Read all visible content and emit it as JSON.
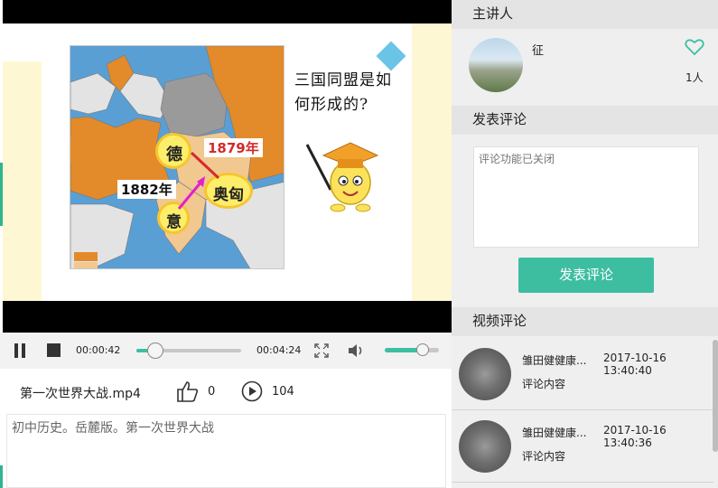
{
  "slide": {
    "question": "三国同盟是如何形成的?",
    "label_de": "德",
    "label_aoxiong": "奥匈",
    "label_yi": "意",
    "year_1879": "1879年",
    "year_1882": "1882年"
  },
  "player": {
    "current_time": "00:00:42",
    "total_time": "00:04:24",
    "progress": 0.18,
    "volume": 0.7
  },
  "video": {
    "filename": "第一次世界大战.mp4",
    "likes": "0",
    "plays": "104",
    "description": "初中历史。岳麓版。第一次世界大战"
  },
  "lecturer": {
    "section_title": "主讲人",
    "name": "征",
    "followers": "1人"
  },
  "comment_form": {
    "section_title": "发表评论",
    "placeholder": "评论功能已关闭",
    "submit_label": "发表评论"
  },
  "comments": {
    "section_title": "视频评论",
    "items": [
      {
        "user": "雏田健健康...",
        "date": "2017-10-16 13:40:40",
        "content": "评论内容"
      },
      {
        "user": "雏田健健康...",
        "date": "2017-10-16 13:40:36",
        "content": "评论内容"
      }
    ]
  },
  "colors": {
    "accent": "#3dbea1",
    "heart": "#3dbea1"
  }
}
